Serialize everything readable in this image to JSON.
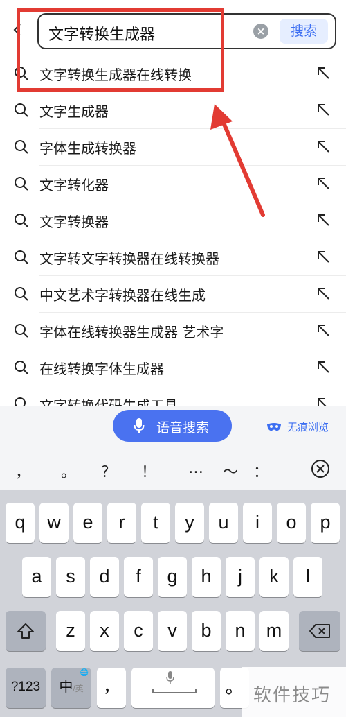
{
  "search": {
    "query": "文字转换生成器",
    "clear_icon": "close-circle-icon",
    "button_label": "搜索"
  },
  "suggestions": [
    {
      "text": "文字转换生成器在线转换"
    },
    {
      "text": "文字生成器"
    },
    {
      "text": "字体生成转换器"
    },
    {
      "text": "文字转化器"
    },
    {
      "text": "文字转换器"
    },
    {
      "text": "文字转文字转换器在线转换器"
    },
    {
      "text": "中文艺术字转换器在线生成"
    },
    {
      "text": "字体在线转换器生成器 艺术字"
    },
    {
      "text": "在线转换字体生成器"
    },
    {
      "text": "文字转换代码生成工具"
    }
  ],
  "voice_bar": {
    "voice_label": "语音搜索",
    "incognito_label": "无痕浏览"
  },
  "keyboard": {
    "punctuation": [
      "，",
      "。",
      "？",
      "！",
      "…",
      "～",
      "："
    ],
    "row1": [
      "q",
      "w",
      "e",
      "r",
      "t",
      "y",
      "u",
      "i",
      "o",
      "p"
    ],
    "row2": [
      "a",
      "s",
      "d",
      "f",
      "g",
      "h",
      "j",
      "k",
      "l"
    ],
    "row3": [
      "z",
      "x",
      "c",
      "v",
      "b",
      "n",
      "m"
    ],
    "num_key": "?123",
    "lang_key_main": "中",
    "lang_key_sub": "/英",
    "comma_key": "，",
    "period_key": "。"
  },
  "watermark": "软件技巧",
  "colors": {
    "accent": "#4a72f0",
    "highlight": "#e23b33",
    "keyboard_bg": "#d1d3d9"
  }
}
